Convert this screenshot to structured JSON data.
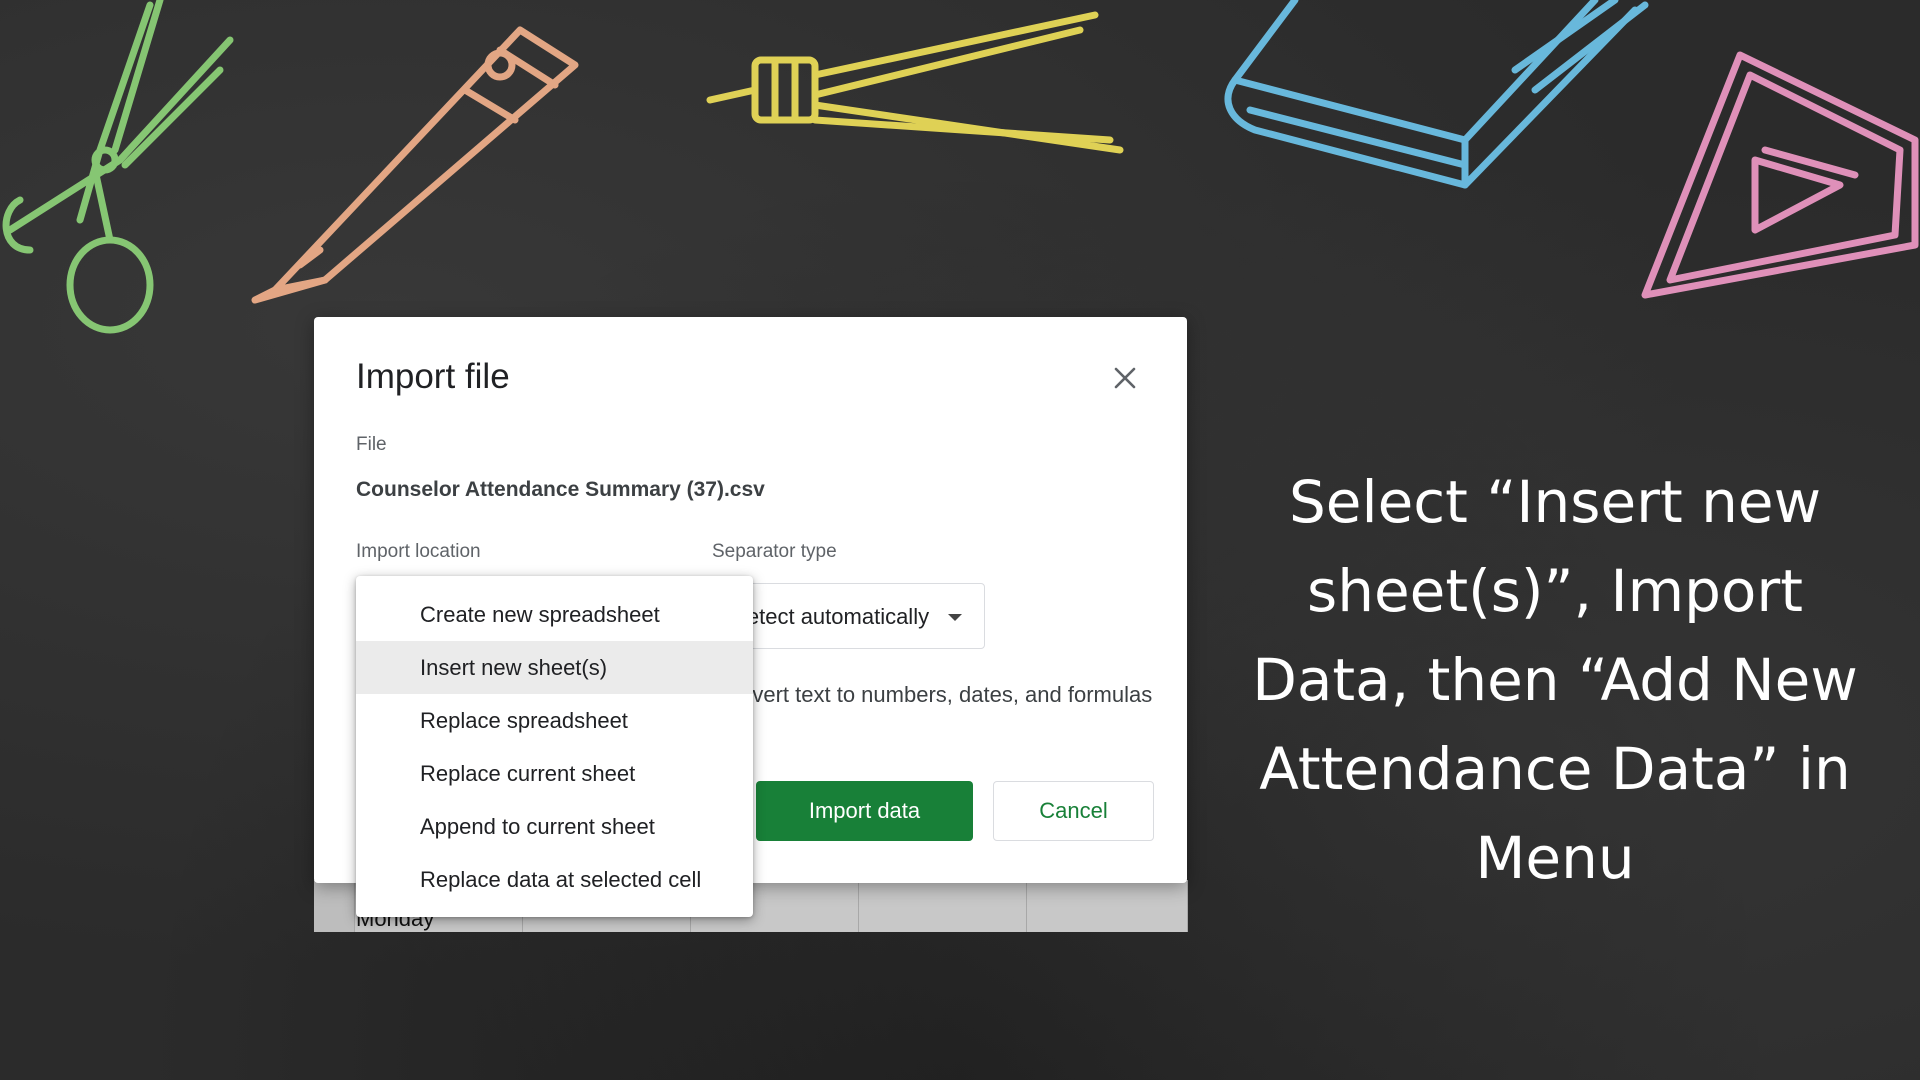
{
  "dialog": {
    "title": "Import file",
    "file_label": "File",
    "file_name": "Counselor Attendance Summary (37).csv",
    "import_location_label": "Import location",
    "separator_label": "Separator type",
    "separator_value": "Detect automatically",
    "convert_text": "Convert text to numbers, dates, and formulas",
    "import_button": "Import data",
    "cancel_button": "Cancel"
  },
  "dropdown": {
    "items": [
      "Create new spreadsheet",
      "Insert new sheet(s)",
      "Replace spreadsheet",
      "Replace current sheet",
      "Append to current sheet",
      "Replace data at selected cell"
    ],
    "selected_index": 1
  },
  "sheet_background": {
    "cell_text": "Monday"
  },
  "caption": "Select “Insert new sheet(s)”, Import Data, then “Add New Attendance Data” in Menu",
  "colors": {
    "primary_green": "#188038",
    "chalk_green": "#8fd67a",
    "chalk_orange": "#f6b38d",
    "chalk_yellow": "#f2e35a",
    "chalk_blue": "#6fc8ef",
    "chalk_pink": "#f39bc9"
  }
}
